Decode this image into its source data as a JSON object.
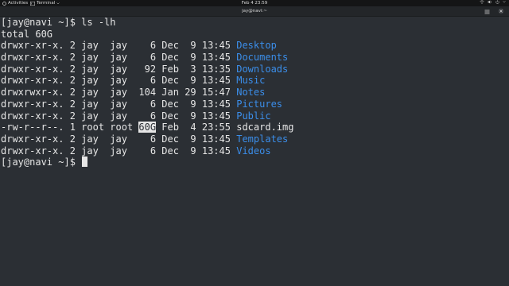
{
  "topbar": {
    "activities_label": "Activities",
    "app_label": "Terminal",
    "clock": "Feb 4  23:59"
  },
  "window": {
    "title": "jay@navi:~"
  },
  "terminal": {
    "prompt": "[jay@navi ~]$",
    "command": "ls -lh",
    "total": "total 60G",
    "entries": [
      {
        "prefix": "drwxr-xr-x. 2 jay  jay    6 Dec  9 13:45 ",
        "name": "Desktop",
        "is_dir": true
      },
      {
        "prefix": "drwxr-xr-x. 2 jay  jay    6 Dec  9 13:45 ",
        "name": "Documents",
        "is_dir": true
      },
      {
        "prefix": "drwxr-xr-x. 2 jay  jay   92 Feb  3 13:35 ",
        "name": "Downloads",
        "is_dir": true
      },
      {
        "prefix": "drwxr-xr-x. 2 jay  jay    6 Dec  9 13:45 ",
        "name": "Music",
        "is_dir": true
      },
      {
        "prefix": "drwxrwxr-x. 2 jay  jay  104 Jan 29 15:47 ",
        "name": "Notes",
        "is_dir": true
      },
      {
        "prefix": "drwxr-xr-x. 2 jay  jay    6 Dec  9 13:45 ",
        "name": "Pictures",
        "is_dir": true
      },
      {
        "prefix": "drwxr-xr-x. 2 jay  jay    6 Dec  9 13:45 ",
        "name": "Public",
        "is_dir": true
      },
      {
        "prefix_before_sel": "-rw-r--r--. 1 root root ",
        "selected": "60G",
        "prefix_after_sel": " Feb  4 23:55 ",
        "name": "sdcard.img",
        "is_dir": false
      },
      {
        "prefix": "drwxr-xr-x. 2 jay  jay    6 Dec  9 13:45 ",
        "name": "Templates",
        "is_dir": true
      },
      {
        "prefix": "drwxr-xr-x. 2 jay  jay    6 Dec  9 13:45 ",
        "name": "Videos",
        "is_dir": true
      }
    ]
  },
  "colors": {
    "background": "#2b2f34",
    "foreground": "#e6e6e6",
    "directory": "#3b8eea",
    "topbar": "#141516"
  },
  "icons": {
    "activities": "activities-icon",
    "terminal": "terminal-icon",
    "network": "network-icon",
    "volume": "volume-icon",
    "power": "power-icon",
    "menu": "hamburger-menu-icon",
    "close": "close-icon"
  }
}
